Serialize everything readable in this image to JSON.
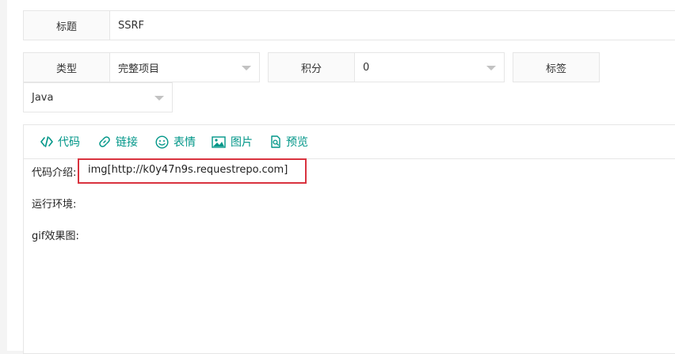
{
  "form": {
    "title_label": "标题",
    "title_value": "SSRF",
    "type_label": "类型",
    "type_value": "完整项目",
    "points_label": "积分",
    "points_value": "0",
    "tags_label": "标签",
    "lang_value": "Java"
  },
  "editor": {
    "toolbar": {
      "code": "代码",
      "link": "链接",
      "emoji": "表情",
      "image": "图片",
      "preview": "预览"
    },
    "lines": {
      "intro_label": "代码介绍:",
      "intro_value": "img[http://k0y47n9s.requestrepo.com]",
      "env_label": "运行环境:",
      "gif_label": "gif效果图:"
    }
  },
  "colors": {
    "accent": "#009688",
    "highlight": "#d9333f"
  }
}
